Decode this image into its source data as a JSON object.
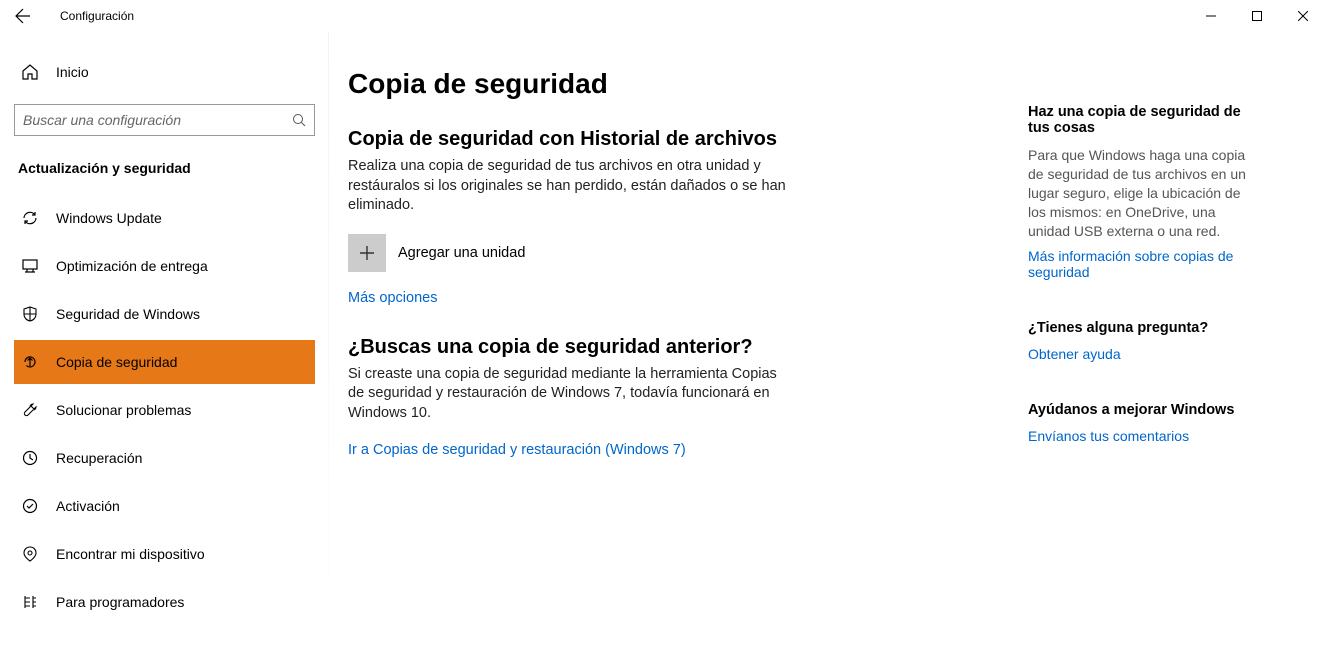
{
  "window": {
    "title": "Configuración"
  },
  "sidebar": {
    "home": "Inicio",
    "search_placeholder": "Buscar una configuración",
    "category": "Actualización y seguridad",
    "items": [
      {
        "label": "Windows Update",
        "icon": "sync"
      },
      {
        "label": "Optimización de entrega",
        "icon": "delivery"
      },
      {
        "label": "Seguridad de Windows",
        "icon": "shield"
      },
      {
        "label": "Copia de seguridad",
        "icon": "backup",
        "highlight": true
      },
      {
        "label": "Solucionar problemas",
        "icon": "troubleshoot"
      },
      {
        "label": "Recuperación",
        "icon": "recovery"
      },
      {
        "label": "Activación",
        "icon": "activation"
      },
      {
        "label": "Encontrar mi dispositivo",
        "icon": "find"
      },
      {
        "label": "Para programadores",
        "icon": "developer"
      }
    ]
  },
  "content": {
    "title": "Copia de seguridad",
    "section1": {
      "heading": "Copia de seguridad con Historial de archivos",
      "body": "Realiza una copia de seguridad de tus archivos en otra unidad y restáuralos si los originales se han perdido, están dañados o se han eliminado.",
      "add_drive": "Agregar una unidad",
      "more_options": "Más opciones"
    },
    "section2": {
      "heading": "¿Buscas una copia de seguridad anterior?",
      "body": "Si creaste una copia de seguridad mediante la herramienta Copias de seguridad y restauración de Windows 7, todavía funcionará en Windows 10.",
      "link": "Ir a Copias de seguridad y restauración (Windows 7)"
    }
  },
  "rail": {
    "section1": {
      "heading": "Haz una copia de seguridad de tus cosas",
      "body": "Para que Windows haga una copia de seguridad de tus archivos en un lugar seguro, elige la ubicación de los mismos: en OneDrive, una unidad USB externa o una red.",
      "link": "Más información sobre copias de seguridad"
    },
    "section2": {
      "heading": "¿Tienes alguna pregunta?",
      "link": "Obtener ayuda"
    },
    "section3": {
      "heading": "Ayúdanos a mejorar Windows",
      "link": "Envíanos tus comentarios"
    }
  }
}
